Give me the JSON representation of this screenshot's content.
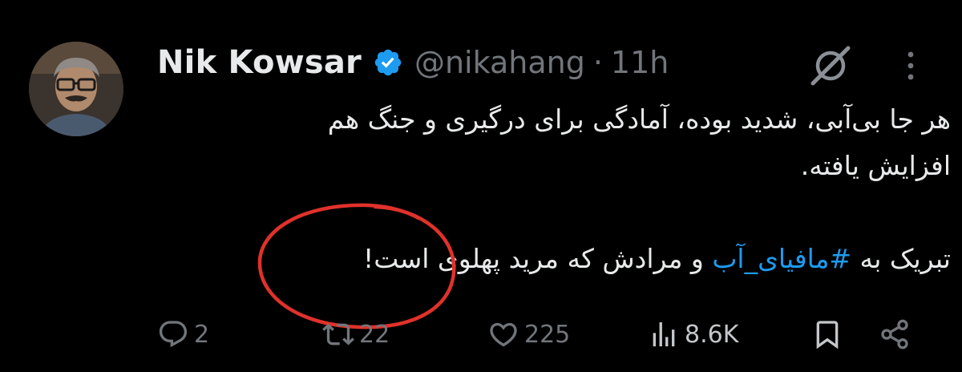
{
  "author": {
    "name": "Nik Kowsar",
    "handle": "@nikahang",
    "separator": "·",
    "time": "11h"
  },
  "tweet": {
    "line1": "هر جا بی‌آبی، شدید بوده، آمادگی برای درگیری و جنگ هم",
    "line2": "افزایش یافته.",
    "line3_before": "تبریک به ",
    "hashtag": "#مافیای_آب",
    "line3_after": " و مرادش که مرید پهلوی است!"
  },
  "actions": {
    "replies": "2",
    "reposts": "22",
    "likes": "225",
    "views": "8.6K"
  },
  "colors": {
    "background": "#000000",
    "text": "#e7e9ea",
    "muted": "#71767b",
    "link": "#1d9bf0",
    "annotation": "#e0312b"
  },
  "icons": [
    "verified-badge-icon",
    "grok-icon",
    "more-icon",
    "reply-icon",
    "repost-icon",
    "like-icon",
    "views-icon",
    "bookmark-icon",
    "share-icon"
  ]
}
